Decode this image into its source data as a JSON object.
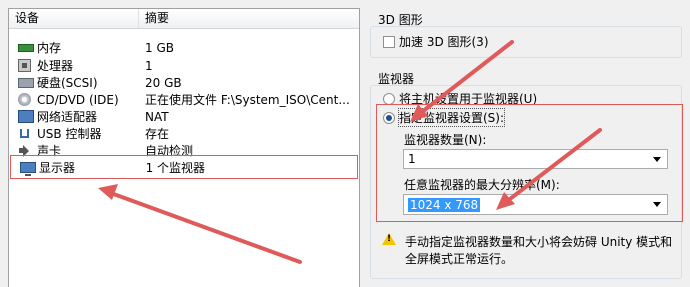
{
  "device_list": {
    "headers": {
      "device": "设备",
      "summary": "摘要"
    },
    "rows": [
      {
        "icon": "memory-icon",
        "name": "内存",
        "summary": "1 GB"
      },
      {
        "icon": "processor-icon",
        "name": "处理器",
        "summary": "1"
      },
      {
        "icon": "hard-disk-icon",
        "name": "硬盘(SCSI)",
        "summary": "20 GB"
      },
      {
        "icon": "cd-dvd-icon",
        "name": "CD/DVD (IDE)",
        "summary": "正在使用文件 F:\\System_ISO\\Cent..."
      },
      {
        "icon": "network-adapter-icon",
        "name": "网络适配器",
        "summary": "NAT"
      },
      {
        "icon": "usb-icon",
        "name": "USB 控制器",
        "summary": "存在"
      },
      {
        "icon": "sound-card-icon",
        "name": "声卡",
        "summary": "自动检测"
      },
      {
        "icon": "display-icon",
        "name": "显示器",
        "summary": "1 个监视器",
        "selected": true
      }
    ]
  },
  "graphics3d": {
    "title": "3D 图形",
    "accelerate_label": "加速 3D 图形(3)",
    "accelerate_checked": false
  },
  "monitors": {
    "title": "监视器",
    "use_host_label": "将主机设置用于监视器(U)",
    "specify_label": "指定监视器设置(S):",
    "selected_option": "specify",
    "count_label": "监视器数量(N):",
    "count_value": "1",
    "max_res_label": "任意监视器的最大分辨率(M):",
    "max_res_value": "1024 x 768"
  },
  "warning": {
    "text_line1": "手动指定监视器数量和大小将会妨碍 Unity 模式和",
    "text_line2": "全屏模式正常运行。"
  },
  "colors": {
    "annotation_red": "#e15a5a",
    "selection_blue": "#3399ff"
  }
}
